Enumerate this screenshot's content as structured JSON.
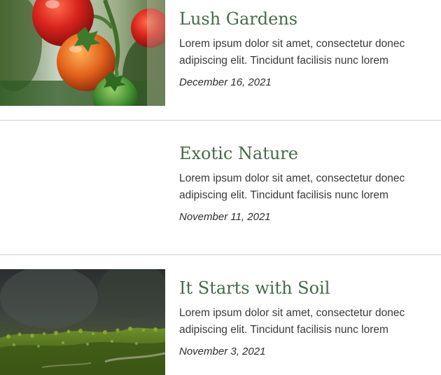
{
  "posts": [
    {
      "title": "Lush Gardens",
      "excerpt": "Lorem ipsum dolor sit amet, consectetur donec adipiscing elit. Tincidunt facilisis nunc lorem",
      "date": "December 16, 2021",
      "image": "tomatoes-photo"
    },
    {
      "title": "Exotic Nature",
      "excerpt": "Lorem ipsum dolor sit amet, consectetur donec adipiscing elit. Tincidunt facilisis nunc lorem",
      "date": "November 11, 2021",
      "image": ""
    },
    {
      "title": "It Starts with Soil",
      "excerpt": "Lorem ipsum dolor sit amet, consectetur donec adipiscing elit. Tincidunt facilisis nunc lorem",
      "date": "November 3, 2021",
      "image": "moss-photo"
    }
  ],
  "colors": {
    "title": "#466b4a",
    "text": "#3a3a3a",
    "divider": "#cfcfcf"
  }
}
